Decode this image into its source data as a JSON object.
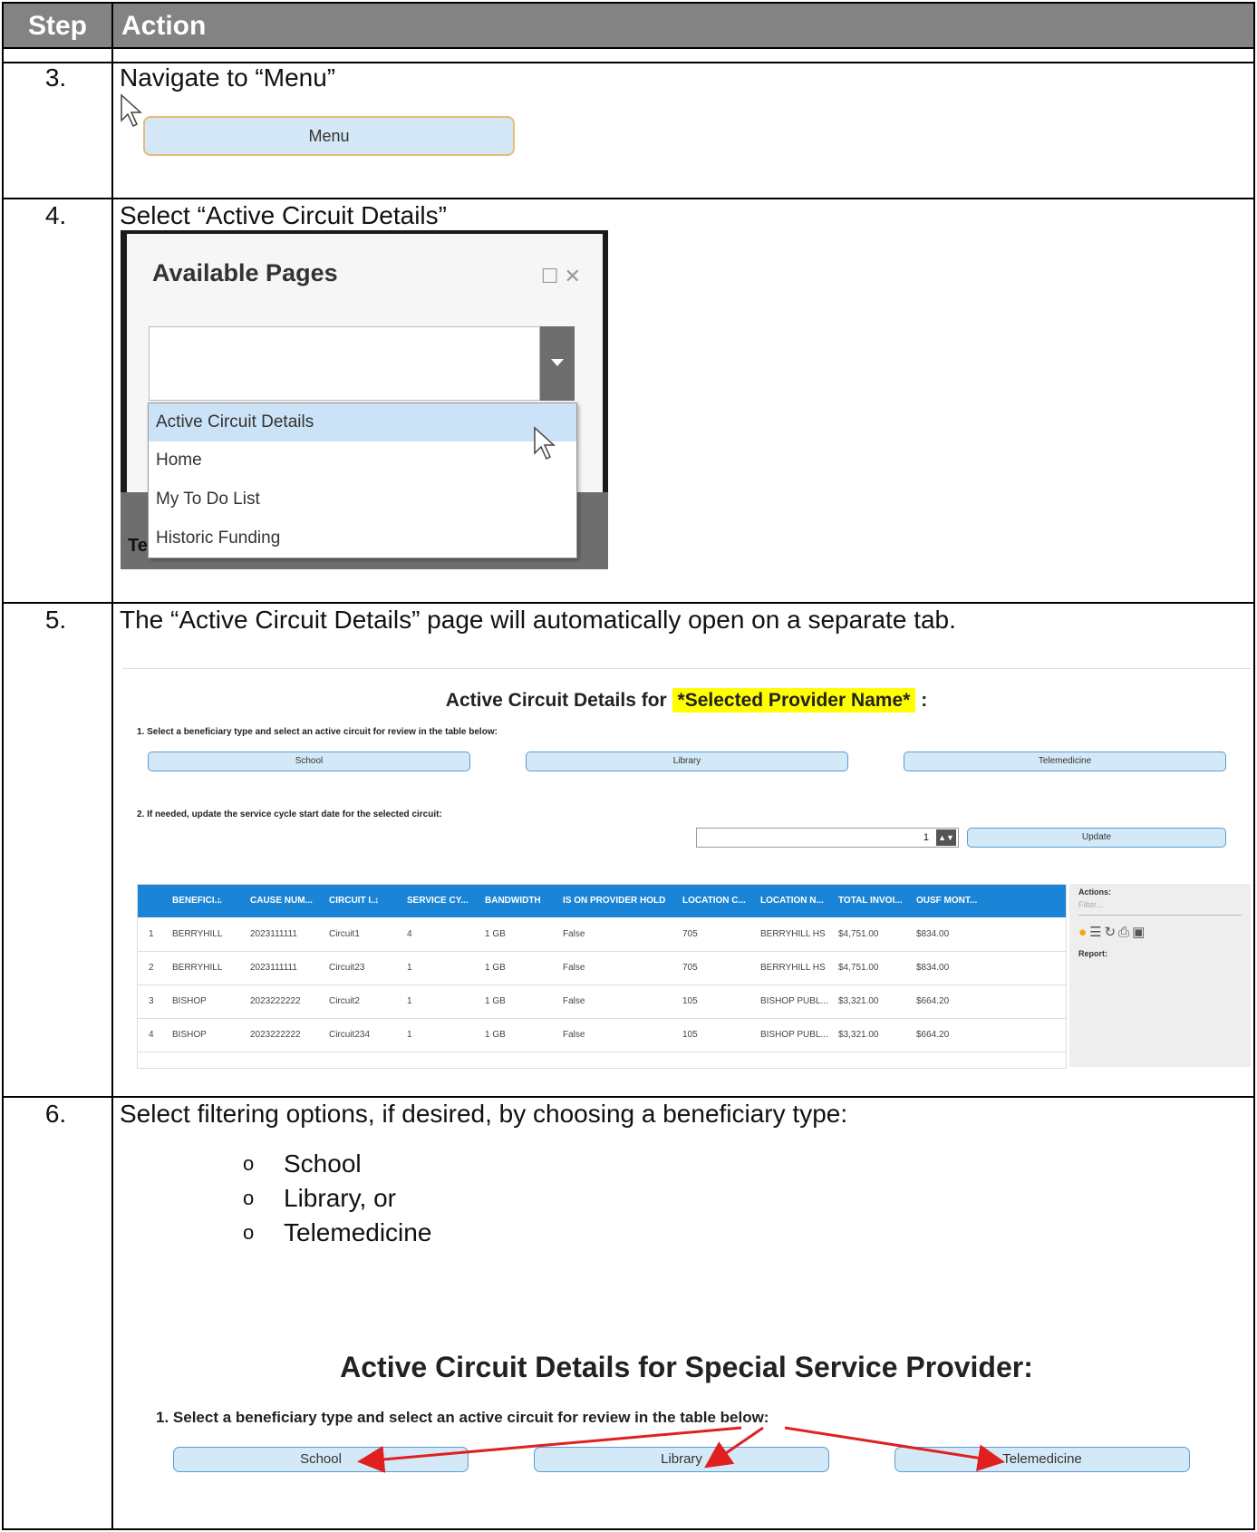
{
  "header": {
    "step": "Step",
    "action": "Action"
  },
  "steps": [
    {
      "num": "3.",
      "text": "Navigate to “Menu”"
    },
    {
      "num": "4.",
      "text": "Select “Active Circuit Details”"
    },
    {
      "num": "5.",
      "text": "The “Active Circuit Details” page will automatically open on a separate tab."
    },
    {
      "num": "6.",
      "text": "Select filtering options, if desired, by choosing a beneficiary type:"
    }
  ],
  "menu_button": "Menu",
  "dialog": {
    "title": "Available Pages",
    "icons": "☐ ✕",
    "options": [
      "Active Circuit Details",
      "Home",
      "My To Do List",
      "Historic Funding"
    ],
    "behind_text": "Te"
  },
  "step5": {
    "title_prefix": "Active Circuit Details for",
    "title_highlight": "*Selected Provider Name*",
    "title_suffix": ":",
    "instruction1": "1. Select a beneficiary type and select an active circuit for review in the table below:",
    "buttons": [
      "School",
      "Library",
      "Telemedicine"
    ],
    "instruction2": "2. If needed, update the service cycle start date for the selected circuit:",
    "spin_value": "1",
    "update_label": "Update",
    "columns": [
      "BENEFICI...",
      "CAUSE NUM...",
      "CIRCUIT I...",
      "SERVICE CY...",
      "BANDWIDTH",
      "IS ON PROVIDER HOLD",
      "LOCATION C...",
      "LOCATION N...",
      "TOTAL INVOI...",
      "OUSF MONT..."
    ],
    "rows": [
      [
        "1",
        "BERRYHILL",
        "2023111111",
        "Circuit1",
        "4",
        "1 GB",
        "False",
        "705",
        "BERRYHILL HS",
        "$4,751.00",
        "$834.00"
      ],
      [
        "2",
        "BERRYHILL",
        "2023111111",
        "Circuit23",
        "1",
        "1 GB",
        "False",
        "705",
        "BERRYHILL HS",
        "$4,751.00",
        "$834.00"
      ],
      [
        "3",
        "BISHOP",
        "2023222222",
        "Circuit2",
        "1",
        "1 GB",
        "False",
        "105",
        "BISHOP PUBL...",
        "$3,321.00",
        "$664.20"
      ],
      [
        "4",
        "BISHOP",
        "2023222222",
        "Circuit234",
        "1",
        "1 GB",
        "False",
        "105",
        "BISHOP PUBL...",
        "$3,321.00",
        "$664.20"
      ]
    ],
    "actions_label": "Actions:",
    "filter_placeholder": "Filter...",
    "report_label": "Report:"
  },
  "step6": {
    "options": [
      "School",
      "Library, or",
      "Telemedicine"
    ],
    "title": "Active Circuit Details for Special Service Provider:",
    "instruction": "1. Select a beneficiary type and select an active circuit for review in the table below:",
    "buttons": [
      "School",
      "Library",
      "Telemedicine"
    ],
    "arrow_color": "#e02020"
  }
}
